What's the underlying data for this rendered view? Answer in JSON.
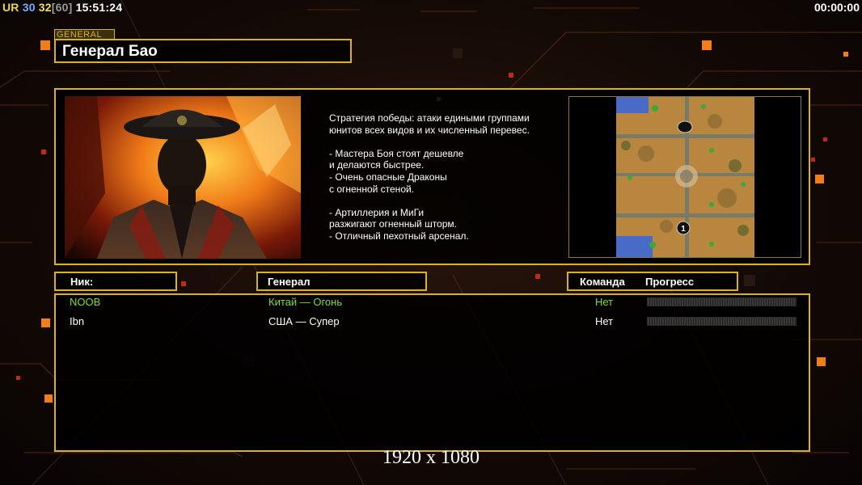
{
  "hud": {
    "ur": "UR",
    "n1": "30",
    "n2": "32",
    "bracket": "[60]",
    "clock": "15:51:24",
    "timer": "00:00:00"
  },
  "general": {
    "tag": "GENERAL",
    "name": "Генерал Бао",
    "description": "Стратегия победы: атаки едиными группами\nюнитов всех видов и их численный перевес.\n\n- Мастера Боя стоят дешевле\nи делаются быстрее.\n- Очень опасные Драконы\nс огненной стеной.\n\n- Артиллерия и МиГи\nразжигают огненный шторм.\n- Отличный пехотный арсенал."
  },
  "map": {
    "start_marker": "1"
  },
  "table": {
    "headers": {
      "nick": "Ник:",
      "general": "Генерал",
      "team": "Команда",
      "progress": "Прогресс"
    },
    "rows": [
      {
        "nick": "NOOB",
        "general": "Китай — Огонь",
        "team": "Нет",
        "progress": 0,
        "color": "#7ddc2c"
      },
      {
        "nick": "Ibn",
        "general": "США — Супер",
        "team": "Нет",
        "progress": 0,
        "color": "#ffffff"
      }
    ]
  },
  "resolution": "1920 x 1080",
  "colors": {
    "accent": "#d9b21e",
    "highlight": "#f07f1a",
    "player": "#7ddc2c"
  }
}
